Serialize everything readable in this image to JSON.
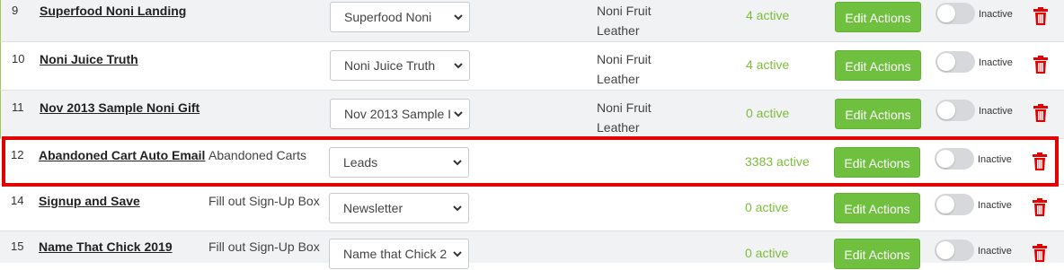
{
  "colors": {
    "accent_green": "#70c040",
    "active_text": "#7cbd3a",
    "delete_red": "#e30000",
    "highlight": "#e30000"
  },
  "rows": [
    {
      "num": "9",
      "name": "Superfood Noni Landing",
      "trigger": "",
      "select": "Superfood Noni",
      "product_line1": "Noni Fruit",
      "product_line2": "Leather",
      "active": "4 active",
      "button": "Edit Actions",
      "toggle": "Inactive"
    },
    {
      "num": "10",
      "name": "Noni Juice Truth",
      "trigger": "",
      "select": "Noni Juice Truth",
      "product_line1": "Noni Fruit",
      "product_line2": "Leather",
      "active": "4 active",
      "button": "Edit Actions",
      "toggle": "Inactive"
    },
    {
      "num": "11",
      "name": "Nov 2013 Sample Noni Gift",
      "trigger": "",
      "select": "Nov 2013 Sample I",
      "product_line1": "Noni Fruit",
      "product_line2": "Leather",
      "active": "0 active",
      "button": "Edit Actions",
      "toggle": "Inactive"
    },
    {
      "num": "12",
      "name": "Abandoned Cart Auto Email",
      "trigger": "Abandoned Carts",
      "select": "Leads",
      "product_line1": "",
      "product_line2": "",
      "active": "3383 active",
      "button": "Edit Actions",
      "toggle": "Inactive"
    },
    {
      "num": "14",
      "name": "Signup and Save",
      "trigger": "Fill out Sign-Up Box",
      "select": "Newsletter",
      "product_line1": "",
      "product_line2": "",
      "active": "0 active",
      "button": "Edit Actions",
      "toggle": "Inactive"
    },
    {
      "num": "15",
      "name": "Name That Chick 2019",
      "trigger": "Fill out Sign-Up Box",
      "select": "Name that Chick 2",
      "product_line1": "",
      "product_line2": "",
      "active": "0 active",
      "button": "Edit Actions",
      "toggle": "Inactive"
    }
  ],
  "icons": {
    "select_arrow": "chevron-down-icon",
    "delete": "trash-icon"
  }
}
